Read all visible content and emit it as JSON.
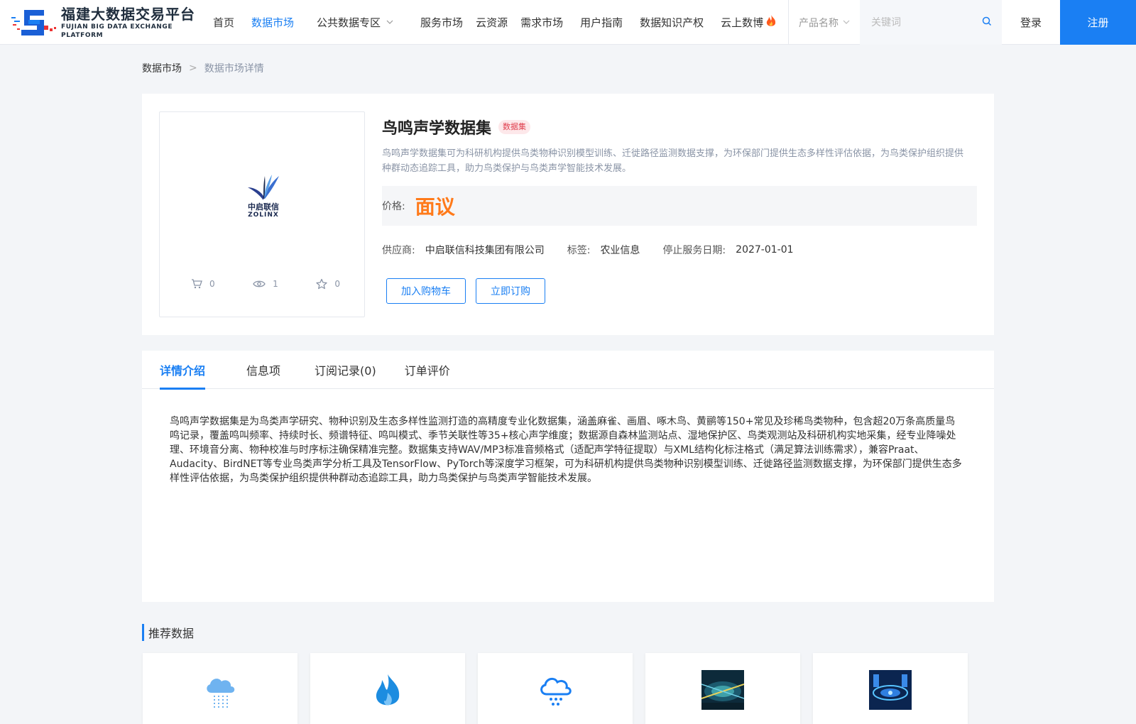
{
  "header": {
    "logo_cn": "福建大数据交易平台",
    "logo_en": "FUJIAN BIG DATA EXCHANGE  PLATFORM",
    "nav": [
      {
        "label": "首页",
        "active": false
      },
      {
        "label": "数据市场",
        "active": true
      },
      {
        "label": "公共数据专区",
        "active": false,
        "dropdown": true
      },
      {
        "label": "服务市场",
        "active": false
      },
      {
        "label": "云资源",
        "active": false
      },
      {
        "label": "需求市场",
        "active": false
      },
      {
        "label": "用户指南",
        "active": false
      },
      {
        "label": "数据知识产权",
        "active": false
      },
      {
        "label": "云上数博",
        "active": false,
        "icon": "flame-icon"
      }
    ],
    "search_scope": "产品名称",
    "search_placeholder": "关键词",
    "login_label": "登录",
    "register_label": "注册"
  },
  "breadcrumb": {
    "parent": "数据市场",
    "separator": ">",
    "current": "数据市场详情"
  },
  "product": {
    "provider_logo_cn": "中启联信",
    "provider_logo_en": "ZOLINX",
    "stats": {
      "cart": "0",
      "views": "1",
      "favorites": "0"
    },
    "title": "鸟鸣声学数据集",
    "badge": "数据集",
    "description": "鸟鸣声学数据集可为科研机构提供鸟类物种识别模型训练、迁徙路径监测数据支撑，为环保部门提供生态多样性评估依据，为鸟类保护组织提供种群动态追踪工具，助力鸟类保护与鸟类声学智能技术发展。",
    "price_label": "价格:",
    "price_value": "面议",
    "supplier_label": "供应商:",
    "supplier_value": "中启联信科技集团有限公司",
    "tag_label": "标签:",
    "tag_value": "农业信息",
    "end_date_label": "停止服务日期:",
    "end_date_value": "2027-01-01",
    "add_cart_label": "加入购物车",
    "subscribe_label": "立即订购"
  },
  "tabs": [
    {
      "label": "详情介绍",
      "active": true
    },
    {
      "label": "信息项",
      "active": false
    },
    {
      "label": "订阅记录(0)",
      "active": false
    },
    {
      "label": "订单评价",
      "active": false
    }
  ],
  "detail_text": "鸟鸣声学数据集是为鸟类声学研究、物种识别及生态多样性监测打造的高精度专业化数据集，涵盖麻雀、画眉、啄木鸟、黄鹂等150+常见及珍稀鸟类物种，包含超20万条高质量鸟鸣记录，覆盖鸣叫频率、持续时长、频谱特征、鸣叫模式、季节关联性等35+核心声学维度；数据源自森林监测站点、湿地保护区、鸟类观测站及科研机构实地采集，经专业降噪处理、环境音分离、物种校准与时序标注确保精准完整。数据集支持WAV/MP3标准音频格式（适配声学特征提取）与XML结构化标注格式（满足算法训练需求），兼容Praat、Audacity、BirdNET等专业鸟类声学分析工具及TensorFlow、PyTorch等深度学习框架，可为科研机构提供鸟类物种识别模型训练、迁徙路径监测数据支撑，为环保部门提供生态多样性评估依据，为鸟类保护组织提供种群动态追踪工具，助力鸟类保护与鸟类声学智能技术发展。",
  "recommend": {
    "title": "推荐数据",
    "items": [
      {
        "icon": "rain-cloud-icon"
      },
      {
        "icon": "flame-icon"
      },
      {
        "icon": "snow-cloud-icon"
      },
      {
        "icon": "city-night-image"
      },
      {
        "icon": "data-center-image"
      }
    ]
  },
  "colors": {
    "accent": "#1a7ff3",
    "price": "#ff7a1a",
    "badge_bg": "#fde8ea",
    "badge_text": "#e0404f"
  }
}
